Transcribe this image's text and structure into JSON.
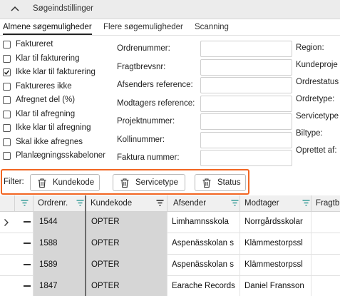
{
  "header": {
    "title": "Søgeindstillinger",
    "icon": "chevron-up-icon"
  },
  "tabs": [
    {
      "label": "Almene søgemuligheder",
      "active": true
    },
    {
      "label": "Flere søgemuligheder",
      "active": false
    },
    {
      "label": "Scanning",
      "active": false
    }
  ],
  "checkboxes": [
    {
      "label": "Faktureret",
      "checked": false
    },
    {
      "label": "Klar til fakturering",
      "checked": false
    },
    {
      "label": "Ikke klar til fakturering",
      "checked": true
    },
    {
      "label": "Faktureres ikke",
      "checked": false
    },
    {
      "label": "Afregnet del (%)",
      "checked": false
    },
    {
      "label": "Klar til afregning",
      "checked": false
    },
    {
      "label": "Ikke klar til afregning",
      "checked": false
    },
    {
      "label": "Skal ikke afregnes",
      "checked": false
    },
    {
      "label": "Planlægningsskabeloner",
      "checked": false
    }
  ],
  "fields": [
    {
      "label": "Ordrenummer:",
      "value": ""
    },
    {
      "label": "Fragtbrevsnr:",
      "value": ""
    },
    {
      "label": "Afsenders reference:",
      "value": ""
    },
    {
      "label": "Modtagers reference:",
      "value": ""
    },
    {
      "label": "Projektnummer:",
      "value": ""
    },
    {
      "label": "Kollinummer:",
      "value": ""
    },
    {
      "label": "Faktura nummer:",
      "value": ""
    }
  ],
  "right_fields": [
    {
      "label": "Region:"
    },
    {
      "label": "Kundeproje"
    },
    {
      "label": "Ordrestatus"
    },
    {
      "label": "Ordretype:"
    },
    {
      "label": "Servicetype"
    },
    {
      "label": "Biltype:"
    },
    {
      "label": "Oprettet af:"
    }
  ],
  "filter": {
    "label": "Filter:",
    "chips": [
      {
        "label": "Kundekode",
        "icon": "trash-icon"
      },
      {
        "label": "Servicetype",
        "icon": "trash-icon"
      },
      {
        "label": "Status",
        "icon": "trash-icon"
      }
    ],
    "highlight_color": "#f26522"
  },
  "grid": {
    "columns": [
      {
        "label": "Ordrenr.",
        "filter_icon": "filter-icon"
      },
      {
        "label": "Kundekode",
        "filter_icon": "filter-active-icon"
      },
      {
        "label": "Afsender",
        "filter_icon": "filter-icon"
      },
      {
        "label": "Modtager",
        "filter_icon": "filter-icon"
      },
      {
        "label": "Fragtbr",
        "filter_icon": "filter-icon"
      }
    ],
    "rows": [
      {
        "ordrenr": "1544",
        "kundekode": "OPTER",
        "afsender": "Limhamnsskola",
        "modtager": "Norrgårdsskolar",
        "current": true
      },
      {
        "ordrenr": "1588",
        "kundekode": "OPTER",
        "afsender": "Aspenässkolan s",
        "modtager": "Klämmestorpssl",
        "current": false
      },
      {
        "ordrenr": "1589",
        "kundekode": "OPTER",
        "afsender": "Aspenässkolan s",
        "modtager": "Klämmestorpssl",
        "current": false
      },
      {
        "ordrenr": "1847",
        "kundekode": "OPTER",
        "afsender": "Earache Records",
        "modtager": "Daniel Fransson",
        "current": false
      }
    ]
  }
}
